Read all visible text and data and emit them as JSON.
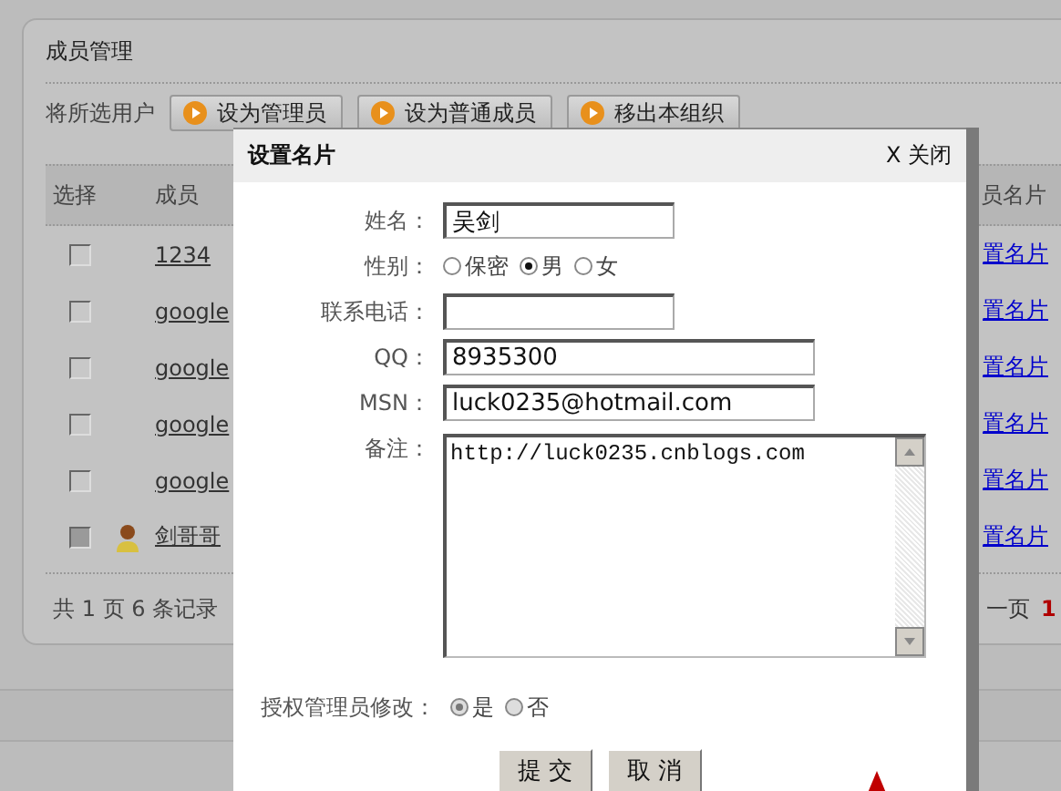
{
  "page": {
    "title": "成员管理",
    "toolbar_label": "将所选用户",
    "toolbar_buttons": [
      "设为管理员",
      "设为普通成员",
      "移出本组织"
    ]
  },
  "table": {
    "columns": [
      "选择",
      "成员",
      "员名片"
    ],
    "rows": [
      {
        "member": "1234",
        "checked": false,
        "disabled": false,
        "avatar": false,
        "action": "置名片"
      },
      {
        "member": "google",
        "checked": false,
        "disabled": false,
        "avatar": false,
        "action": "置名片"
      },
      {
        "member": "google",
        "checked": false,
        "disabled": false,
        "avatar": false,
        "action": "置名片"
      },
      {
        "member": "google",
        "checked": false,
        "disabled": false,
        "avatar": false,
        "action": "置名片"
      },
      {
        "member": "google",
        "checked": false,
        "disabled": false,
        "avatar": false,
        "action": "置名片"
      },
      {
        "member": "剑哥哥",
        "checked": false,
        "disabled": true,
        "avatar": true,
        "action": "置名片"
      }
    ]
  },
  "pager": {
    "summary": "共 1 页 6 条记录",
    "prev": "一页",
    "current": "1"
  },
  "dialog": {
    "title": "设置名片",
    "close": "X 关闭",
    "fields": [
      {
        "kind": "text",
        "label": "姓名：",
        "value": "吴剑"
      },
      {
        "kind": "radio",
        "label": "性别：",
        "disabled": false,
        "options": [
          {
            "label": "保密",
            "selected": false
          },
          {
            "label": "男",
            "selected": true
          },
          {
            "label": "女",
            "selected": false
          }
        ]
      },
      {
        "kind": "text",
        "label": "联系电话："
      },
      {
        "kind": "wide-text",
        "label": "QQ：",
        "value": "8935300"
      },
      {
        "kind": "wide-text",
        "label": "MSN：",
        "value": "luck0235@hotmail.com"
      },
      {
        "kind": "textarea",
        "label": "备注：",
        "value": "http://luck0235.cnblogs.com"
      },
      {
        "kind": "radio",
        "label": "授权管理员修改：",
        "disabled": true,
        "options": [
          {
            "label": "是",
            "selected": true
          },
          {
            "label": "否",
            "selected": false
          }
        ]
      }
    ],
    "buttons": [
      "提 交",
      "取 消"
    ]
  }
}
